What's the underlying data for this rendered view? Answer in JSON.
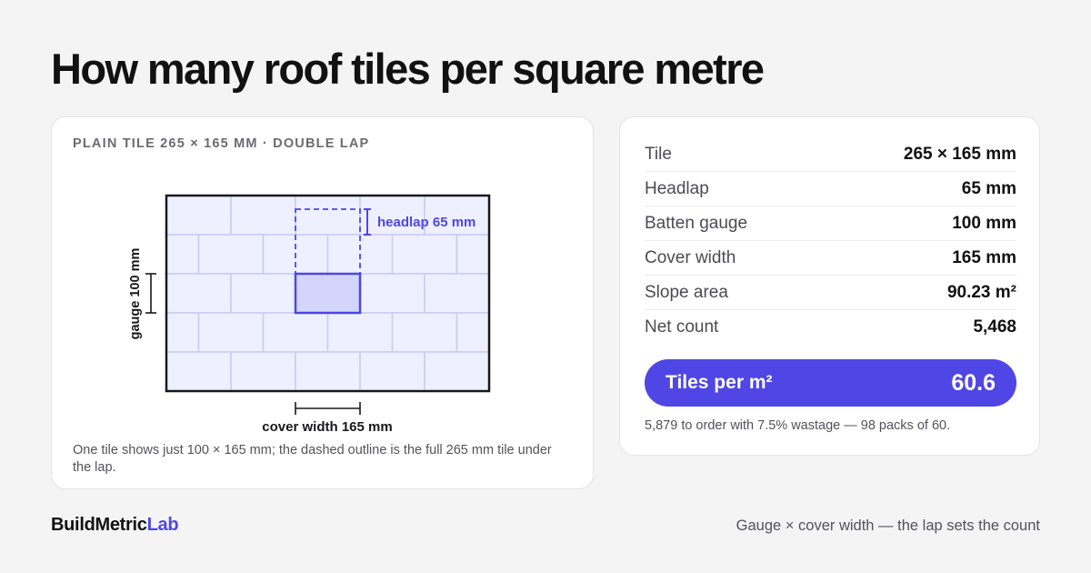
{
  "title": "How many roof tiles per square metre",
  "diagram": {
    "kicker": "PLAIN TILE 265 × 165 MM · DOUBLE LAP",
    "headlap_label": "headlap 65 mm",
    "gauge_label": "gauge 100 mm",
    "cover_width_label": "cover width 165 mm",
    "caption": "One tile shows just 100 × 165 mm; the dashed outline is the full 265 mm tile under the lap.",
    "colors": {
      "accent": "#4f46e5",
      "tile_fill": "#eef0ff",
      "tile_stroke": "#c9cdf6",
      "highlight_fill": "#d3d5fa",
      "frame": "#18181b"
    }
  },
  "stats": {
    "rows": [
      {
        "label": "Tile",
        "value": "265 × 165 mm"
      },
      {
        "label": "Headlap",
        "value": "65 mm"
      },
      {
        "label": "Batten gauge",
        "value": "100 mm"
      },
      {
        "label": "Cover width",
        "value": "165 mm"
      },
      {
        "label": "Slope area",
        "value": "90.23 m²"
      },
      {
        "label": "Net count",
        "value": "5,468"
      }
    ],
    "result_label": "Tiles per m²",
    "result_value": "60.6",
    "order_note": "5,879 to order with 7.5% wastage — 98 packs of 60."
  },
  "footer": {
    "brand_part1": "BuildMetric",
    "brand_part2": "Lab",
    "tagline": "Gauge × cover width — the lap sets the count"
  }
}
